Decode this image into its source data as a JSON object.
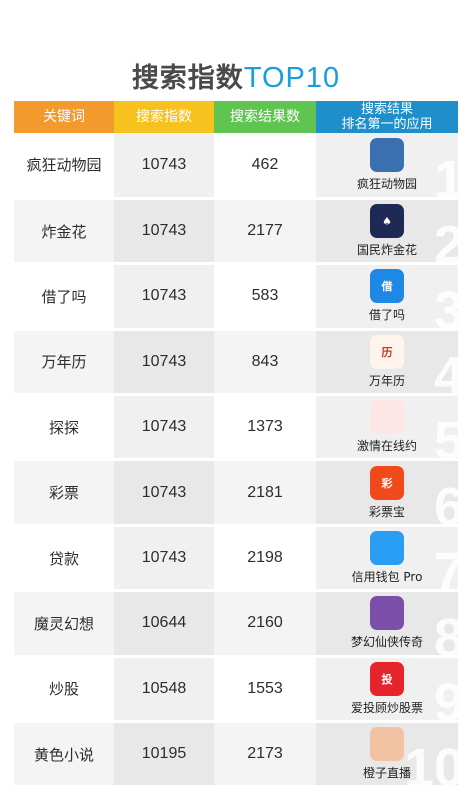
{
  "title": {
    "part1": "搜索指数",
    "part2": "TOP10"
  },
  "chart_data": {
    "type": "table",
    "columns": [
      "关键词",
      "搜索指数",
      "搜索结果数",
      "搜索结果\n排名第一的应用"
    ],
    "rows": [
      {
        "rank": "1",
        "keyword": "疯狂动物园",
        "index": "10743",
        "results": "462",
        "app": "疯狂动物园"
      },
      {
        "rank": "2",
        "keyword": "炸金花",
        "index": "10743",
        "results": "2177",
        "app": "国民炸金花"
      },
      {
        "rank": "3",
        "keyword": "借了吗",
        "index": "10743",
        "results": "583",
        "app": "借了吗"
      },
      {
        "rank": "4",
        "keyword": "万年历",
        "index": "10743",
        "results": "843",
        "app": "万年历"
      },
      {
        "rank": "5",
        "keyword": "探探",
        "index": "10743",
        "results": "1373",
        "app": "激情在线约"
      },
      {
        "rank": "6",
        "keyword": "彩票",
        "index": "10743",
        "results": "2181",
        "app": "彩票宝"
      },
      {
        "rank": "7",
        "keyword": "贷款",
        "index": "10743",
        "results": "2198",
        "app": "信用钱包 Pro"
      },
      {
        "rank": "8",
        "keyword": "魔灵幻想",
        "index": "10644",
        "results": "2160",
        "app": "梦幻仙侠传奇"
      },
      {
        "rank": "9",
        "keyword": "炒股",
        "index": "10548",
        "results": "1553",
        "app": "爱投顾炒股票"
      },
      {
        "rank": "10",
        "keyword": "黄色小说",
        "index": "10195",
        "results": "2173",
        "app": "橙子直播"
      }
    ]
  },
  "icons": [
    {
      "name": "zoo-app-icon",
      "color": "#3a6fb0",
      "glyph": ""
    },
    {
      "name": "poker-app-icon",
      "color": "#1e2a55",
      "glyph": "♠"
    },
    {
      "name": "jieleme-app-icon",
      "color": "#1e88e5",
      "glyph": "借"
    },
    {
      "name": "calendar-app-icon",
      "color": "#fff4ec",
      "glyph": "历"
    },
    {
      "name": "lips-app-icon",
      "color": "#ffe6e6",
      "glyph": ""
    },
    {
      "name": "lottery-app-icon",
      "color": "#f04a1a",
      "glyph": "彩"
    },
    {
      "name": "wallet-app-icon",
      "color": "#2a9df4",
      "glyph": ""
    },
    {
      "name": "fantasy-game-icon",
      "color": "#7b4fa8",
      "glyph": ""
    },
    {
      "name": "stock-app-icon",
      "color": "#e6242b",
      "glyph": "投"
    },
    {
      "name": "live-app-icon",
      "color": "#f2c3a2",
      "glyph": ""
    }
  ]
}
